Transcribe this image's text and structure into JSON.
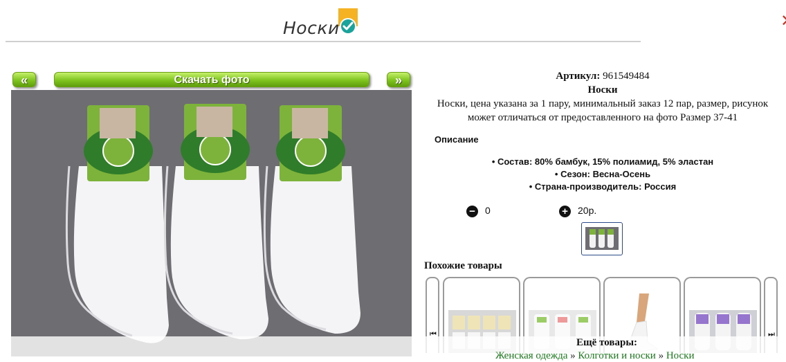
{
  "header": {
    "title": "Носки",
    "badge_icon": "verified-check-icon"
  },
  "gallery": {
    "prev_label": "«",
    "next_label": "»",
    "download_label": "Скачать фото"
  },
  "product": {
    "article_label": "Артикул:",
    "article_value": "961549484",
    "name": "Носки",
    "summary": "Носки, цена указана за 1 пару, минимальный заказ 12 пар, размер, рисунок может отличаться от предоставленного на фото Размер 37-41",
    "description_heading": "Описание",
    "properties": [
      "Состав: 80% бамбук, 15% полиамид, 5% эластан",
      "Сезон: Весна-Осень",
      "Страна-производитель: Россия"
    ]
  },
  "cart": {
    "minus_icon": "minus-circle-icon",
    "quantity": "0",
    "plus_icon": "plus-circle-icon",
    "price": "20р."
  },
  "similar": {
    "heading": "Похожие товары",
    "prev_icon": "skip-back-icon",
    "next_icon": "skip-forward-icon"
  },
  "more": {
    "label": "Ещё товары:",
    "breadcrumbs": [
      "Женская одежда",
      "Колготки и носки",
      "Носки"
    ],
    "separator": "»"
  },
  "colors": {
    "accent_green": "#7fc41f",
    "photo_bg": "#6e6e72",
    "badge_orange": "#f5b324",
    "badge_teal": "#1aa39a"
  }
}
